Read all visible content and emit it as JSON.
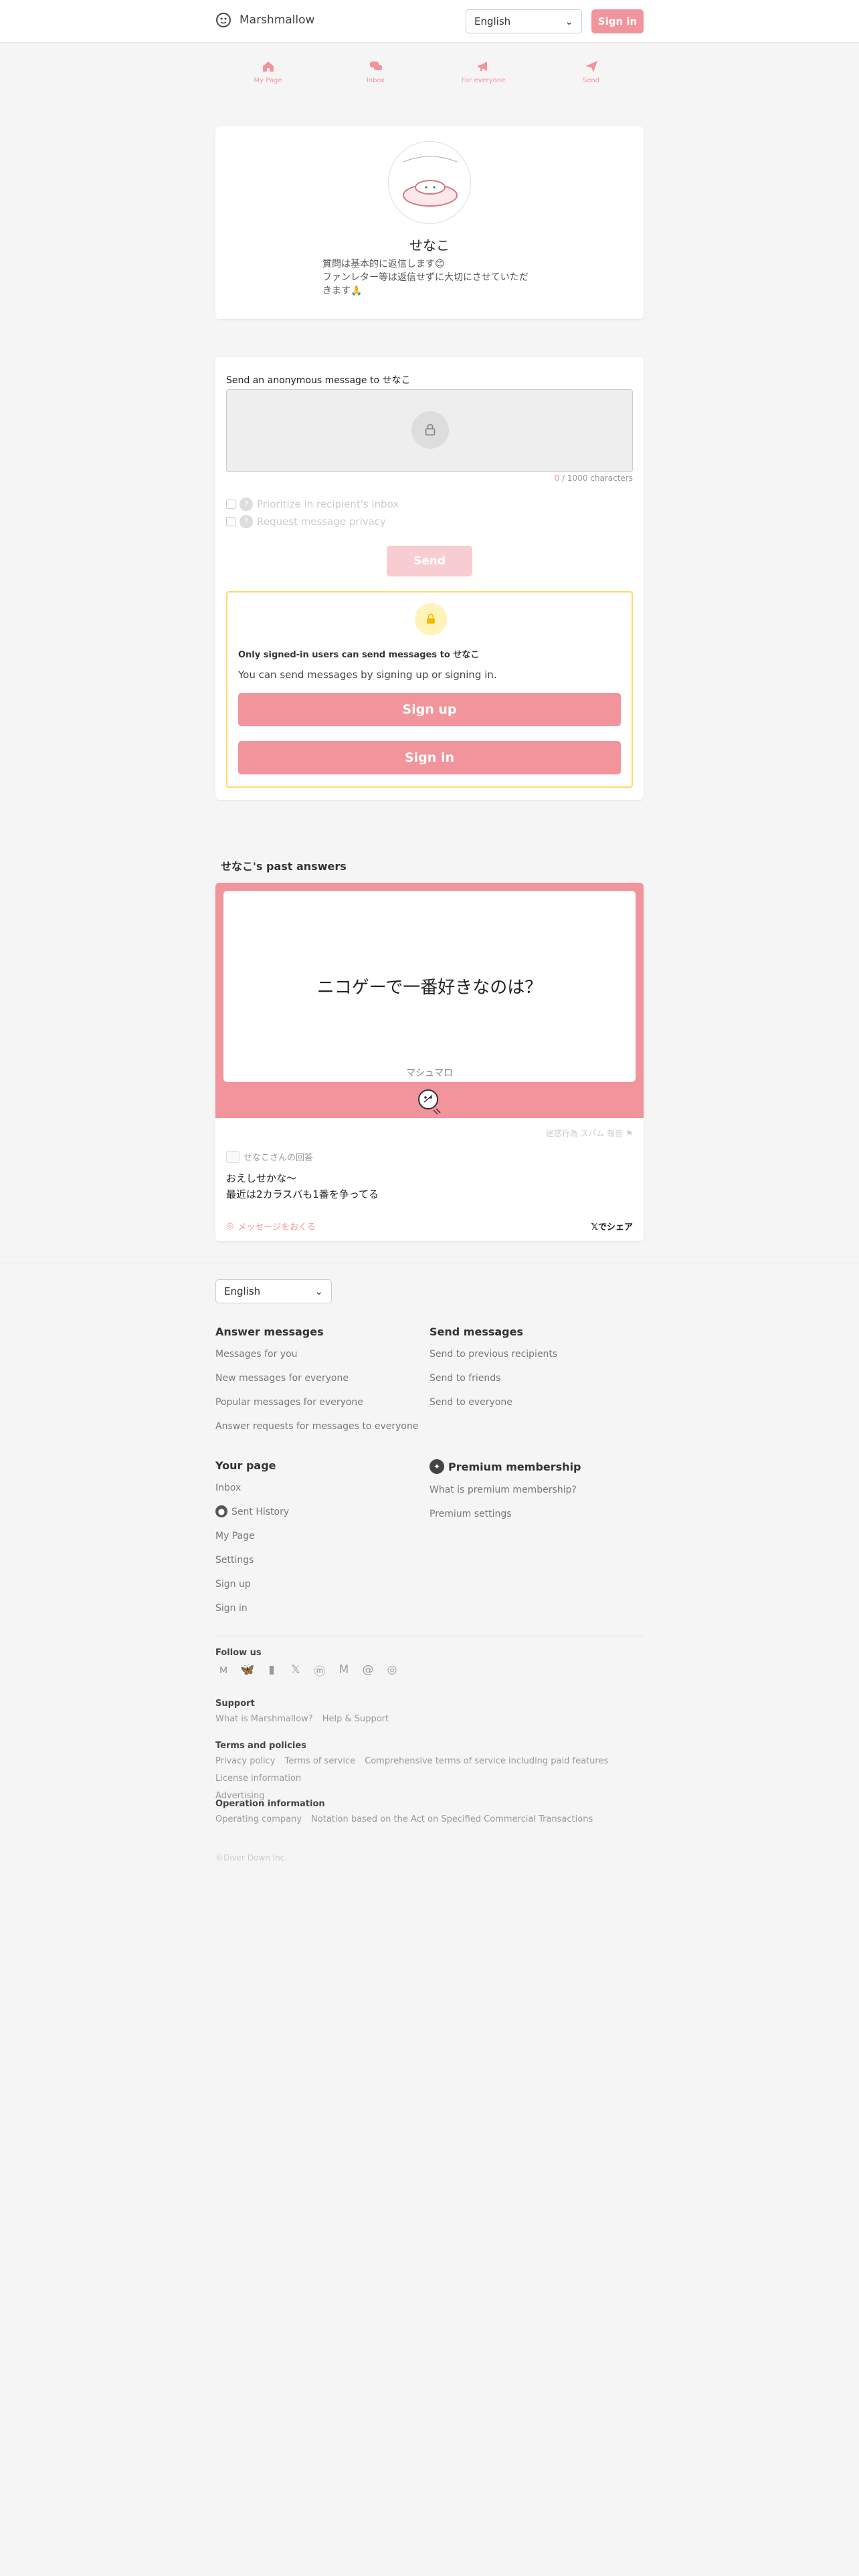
{
  "header": {
    "app_name": "Marshmallow",
    "language": "English",
    "signin": "Sign in"
  },
  "nav": [
    {
      "label": "My Page",
      "icon": "home-icon"
    },
    {
      "label": "Inbox",
      "icon": "chat-icon"
    },
    {
      "label": "For everyone",
      "icon": "megaphone-icon"
    },
    {
      "label": "Send",
      "icon": "paper-plane-icon"
    }
  ],
  "profile": {
    "name": "せなこ",
    "bio": "質問は基本的に返信します😊\nファンレター等は返信せずに大切にさせていただ\nきます🙏"
  },
  "send": {
    "label": "Send an anonymous message to せなこ",
    "count": "0",
    "count_suffix": " / 1000 characters",
    "opt_prioritize": "Prioritize in recipient's inbox",
    "opt_privacy": "Request message privacy",
    "send_button": "Send",
    "gate_title": "Only signed-in users can send messages to せなこ",
    "gate_desc": "You can send messages by signing up or signing in.",
    "signup_button": "Sign up",
    "signin_button": "Sign in"
  },
  "past": {
    "title": "せなこ's past answers",
    "question": "ニコゲーで一番好きなのは？",
    "brand": "マシュマロ",
    "report": "迷惑行為 スパム 報告",
    "author": "せなこさんの回答",
    "answer": "おえしせかな〜\n最近は2カラスバも1番を争ってる",
    "send_message": "メッセージをおくる",
    "share": "でシェア"
  },
  "footer": {
    "language": "English",
    "answer_head": "Answer messages",
    "answer_links": [
      "Messages for you",
      "New messages for everyone",
      "Popular messages for everyone",
      "Answer requests for messages to everyone"
    ],
    "send_head": "Send messages",
    "send_links": [
      "Send to previous recipients",
      "Send to friends",
      "Send to everyone"
    ],
    "your_head": "Your page",
    "your_links": [
      "Inbox",
      "Sent History",
      "My Page",
      "Settings",
      "Sign up",
      "Sign in"
    ],
    "premium_head": "Premium membership",
    "premium_links": [
      "What is premium membership?",
      "Premium settings"
    ],
    "follow_head": "Follow us",
    "support_head": "Support",
    "support_links": [
      "What is Marshmallow?",
      "Help & Support"
    ],
    "terms_head": "Terms and policies",
    "terms_links": [
      "Privacy policy",
      "Terms of service",
      "Comprehensive terms of service including paid features",
      "License information",
      "Advertising"
    ],
    "ops_head": "Operation information",
    "ops_links": [
      "Operating company",
      "Notation based on the Act on Specified Commercial Transactions"
    ],
    "copyright": "©Diver Down Inc."
  },
  "colors": {
    "accent": "#f2949b",
    "accent_light": "#f8cdd1",
    "gate_border": "#ffd966"
  }
}
